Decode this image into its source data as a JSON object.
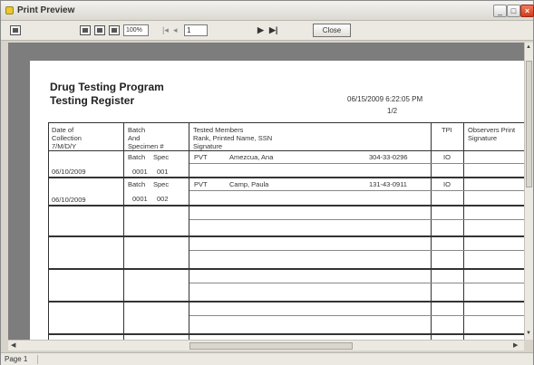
{
  "window": {
    "title": "Print Preview",
    "minimize": "_",
    "maximize": "□",
    "close": "×"
  },
  "toolbar": {
    "zoom_value": "100%",
    "nav_first": "|◂",
    "nav_prev": "◂",
    "page_value": "1",
    "nav_next": "▶",
    "nav_last": "▶|",
    "close_label": "Close"
  },
  "report": {
    "title": "Drug Testing Program",
    "subtitle": "Testing Register",
    "datetime": "06/15/2009 6:22:05 PM",
    "page_label": "1/2",
    "headers": {
      "date": "Date of\nCollection\n7/M/D/Y",
      "batch": "Batch\nAnd\nSpecimen #",
      "tested": "Tested Members\nRank, Printed Name, SSN\nSignature",
      "tpi": "TPI",
      "observer": "Observers Print\nSignature"
    },
    "rows": [
      {
        "date": "06/10/2009",
        "batch_label": "Batch",
        "spec_label": "Spec",
        "batch_no": "0001",
        "spec_no": "001",
        "rank": "PVT",
        "name": "Amezcua, Ana",
        "ssn": "304-33-0296",
        "tpi": "IO"
      },
      {
        "date": "06/10/2009",
        "batch_label": "Batch",
        "spec_label": "Spec",
        "batch_no": "0001",
        "spec_no": "002",
        "rank": "PVT",
        "name": "Camp, Paula",
        "ssn": "131-43-0911",
        "tpi": "IO"
      }
    ]
  },
  "statusbar": {
    "text": "Page 1"
  },
  "icons": {
    "app": "printer-app-icon",
    "print": "print-icon",
    "view1": "single-page-icon",
    "view2": "two-page-icon",
    "view3": "multi-page-icon"
  }
}
